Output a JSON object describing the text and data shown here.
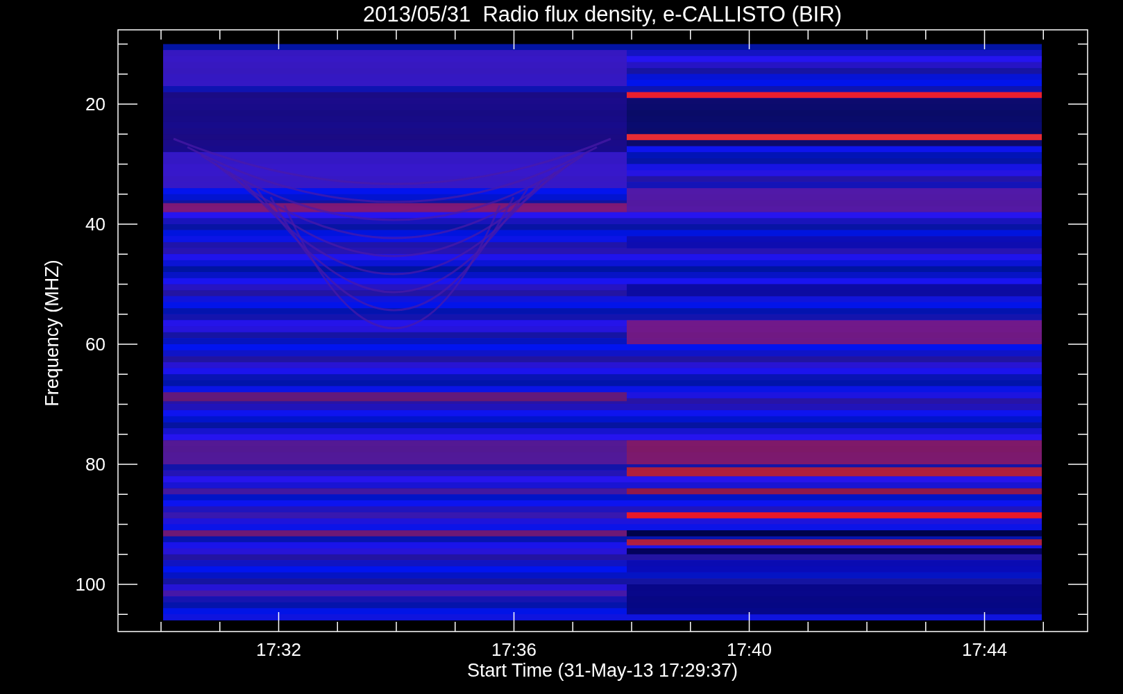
{
  "title": "2013/05/31  Radio flux density, e-CALLISTO (BIR)",
  "ylabel": "Frequency (MHZ)",
  "xlabel": "Start Time (31-May-13 17:29:37)",
  "yticks": [
    "20",
    "40",
    "60",
    "80",
    "100"
  ],
  "xticks": [
    "17:32",
    "17:36",
    "17:40",
    "17:44"
  ]
}
